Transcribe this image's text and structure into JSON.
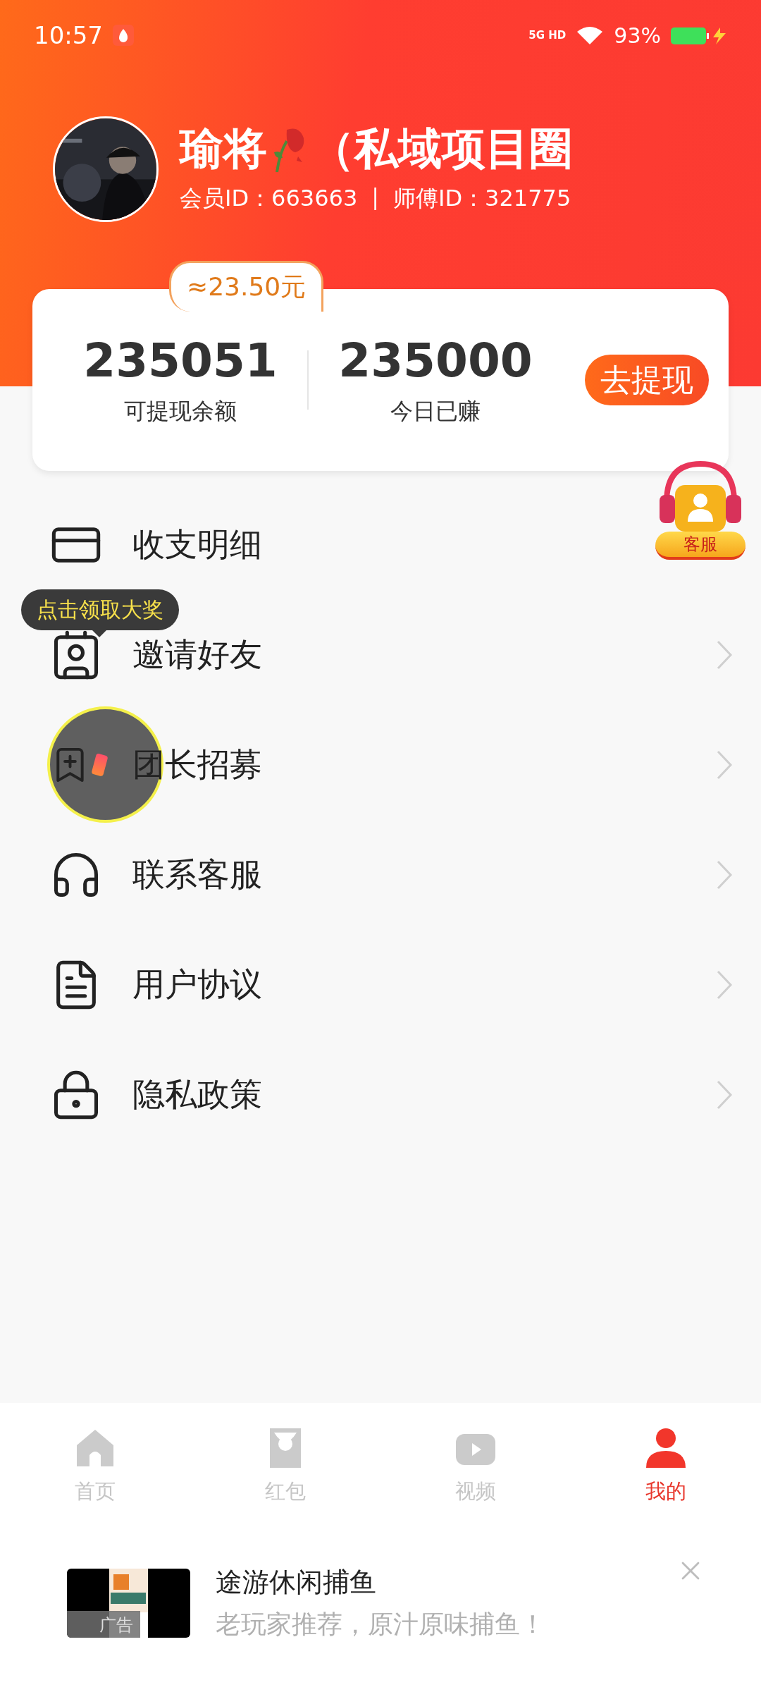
{
  "status_bar": {
    "time": "10:57",
    "network": "5G HD",
    "battery": "93%"
  },
  "profile": {
    "name": "瑜将",
    "name_suffix": "（私域项目圈",
    "member_id": "会员ID：663663",
    "separator": "|",
    "master_id": "师傅ID：321775"
  },
  "wallet": {
    "estimate": "≈23.50元",
    "stats": [
      {
        "value": "235051",
        "label": "可提现余额"
      },
      {
        "value": "235000",
        "label": "今日已赚"
      }
    ],
    "withdraw_button": "去提现"
  },
  "service_float": {
    "label": "客服"
  },
  "tooltip": {
    "text": "点击领取大奖"
  },
  "menu": [
    {
      "kind": "card",
      "label": "收支明细",
      "chevron": false,
      "spotlight": false
    },
    {
      "kind": "invite",
      "label": "邀请好友",
      "chevron": true,
      "spotlight": false
    },
    {
      "kind": "bookmark",
      "label": "团长招募",
      "chevron": true,
      "spotlight": true
    },
    {
      "kind": "headset",
      "label": "联系客服",
      "chevron": true,
      "spotlight": false
    },
    {
      "kind": "document",
      "label": "用户协议",
      "chevron": true,
      "spotlight": false
    },
    {
      "kind": "lock",
      "label": "隐私政策",
      "chevron": true,
      "spotlight": false
    }
  ],
  "tabs": [
    {
      "kind": "home",
      "label": "首页",
      "selected": false
    },
    {
      "kind": "packet",
      "label": "红包",
      "selected": false
    },
    {
      "kind": "video",
      "label": "视频",
      "selected": false
    },
    {
      "kind": "user",
      "label": "我的",
      "selected": true
    }
  ],
  "ad": {
    "title": "途游休闲捕鱼",
    "subtitle": "老玩家推荐，原汁原味捕鱼！",
    "tag": "广告"
  }
}
